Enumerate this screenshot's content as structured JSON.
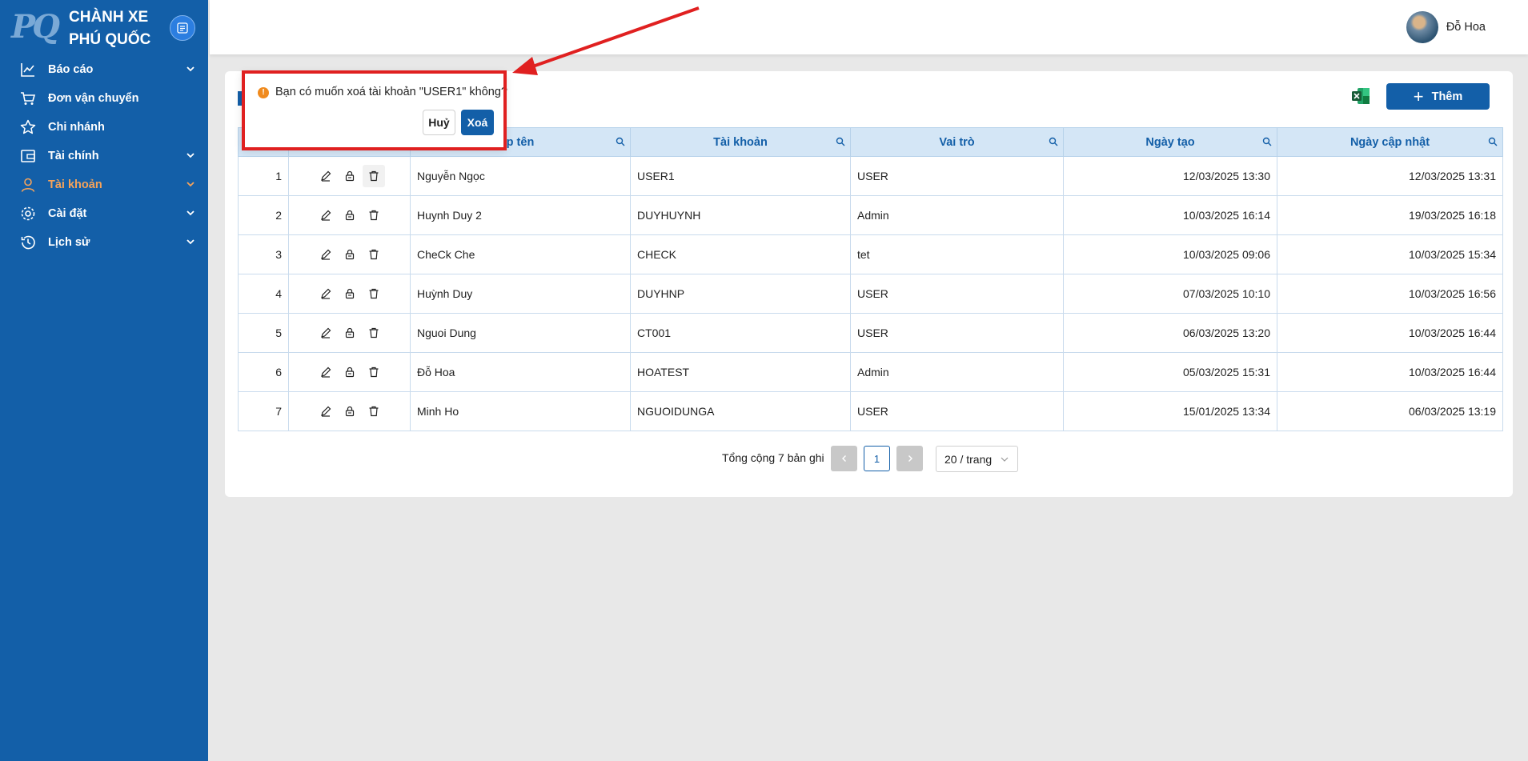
{
  "brand": {
    "logo_text": "PQ",
    "line1": "CHÀNH XE",
    "line2": "PHÚ QUỐC"
  },
  "sidebar": {
    "items": [
      {
        "label": "Báo cáo",
        "icon": "chart-line-icon",
        "has_chevron": true
      },
      {
        "label": "Đơn vận chuyển",
        "icon": "cart-icon",
        "has_chevron": false
      },
      {
        "label": "Chi nhánh",
        "icon": "star-icon",
        "has_chevron": false
      },
      {
        "label": "Tài chính",
        "icon": "wallet-icon",
        "has_chevron": true
      },
      {
        "label": "Tài khoản",
        "icon": "user-icon",
        "has_chevron": true,
        "active": true
      },
      {
        "label": "Cài đặt",
        "icon": "gear-icon",
        "has_chevron": true
      },
      {
        "label": "Lịch sử",
        "icon": "history-icon",
        "has_chevron": true
      }
    ]
  },
  "header": {
    "user_name": "Đỗ Hoa"
  },
  "toolbar": {
    "add_label": "Thêm"
  },
  "table": {
    "columns": [
      "",
      "",
      "p tên",
      "Tài khoản",
      "Vai trò",
      "Ngày tạo",
      "Ngày cập nhật"
    ],
    "rows": [
      [
        "1",
        "Nguyễn Ngọc",
        "USER1",
        "USER",
        "12/03/2025 13:30",
        "12/03/2025 13:31"
      ],
      [
        "2",
        "Huynh Duy 2",
        "DUYHUYNH",
        "Admin",
        "10/03/2025 16:14",
        "19/03/2025 16:18"
      ],
      [
        "3",
        "CheCk Che",
        "CHECK",
        "tet",
        "10/03/2025 09:06",
        "10/03/2025 15:34"
      ],
      [
        "4",
        "Huỳnh Duy",
        "DUYHNP",
        "USER",
        "07/03/2025 10:10",
        "10/03/2025 16:56"
      ],
      [
        "5",
        "Nguoi Dung",
        "CT001",
        "USER",
        "06/03/2025 13:20",
        "10/03/2025 16:44"
      ],
      [
        "6",
        "Đỗ Hoa",
        "HOATEST",
        "Admin",
        "05/03/2025 15:31",
        "10/03/2025 16:44"
      ],
      [
        "7",
        "Minh Ho",
        "NGUOIDUNGA",
        "USER",
        "15/01/2025 13:34",
        "06/03/2025 13:19"
      ]
    ]
  },
  "pagination": {
    "total_text": "Tổng cộng 7 bản ghi",
    "current_page": "1",
    "page_size": "20 / trang"
  },
  "popconfirm": {
    "icon_text": "!",
    "message": "Bạn có muốn xoá tài khoản \"USER1\" không?",
    "cancel_label": "Huỷ",
    "ok_label": "Xoá"
  },
  "colors": {
    "primary": "#135fa8",
    "active_nav": "#f5a35a",
    "annotation": "#e02020",
    "warning": "#f08a1d"
  }
}
